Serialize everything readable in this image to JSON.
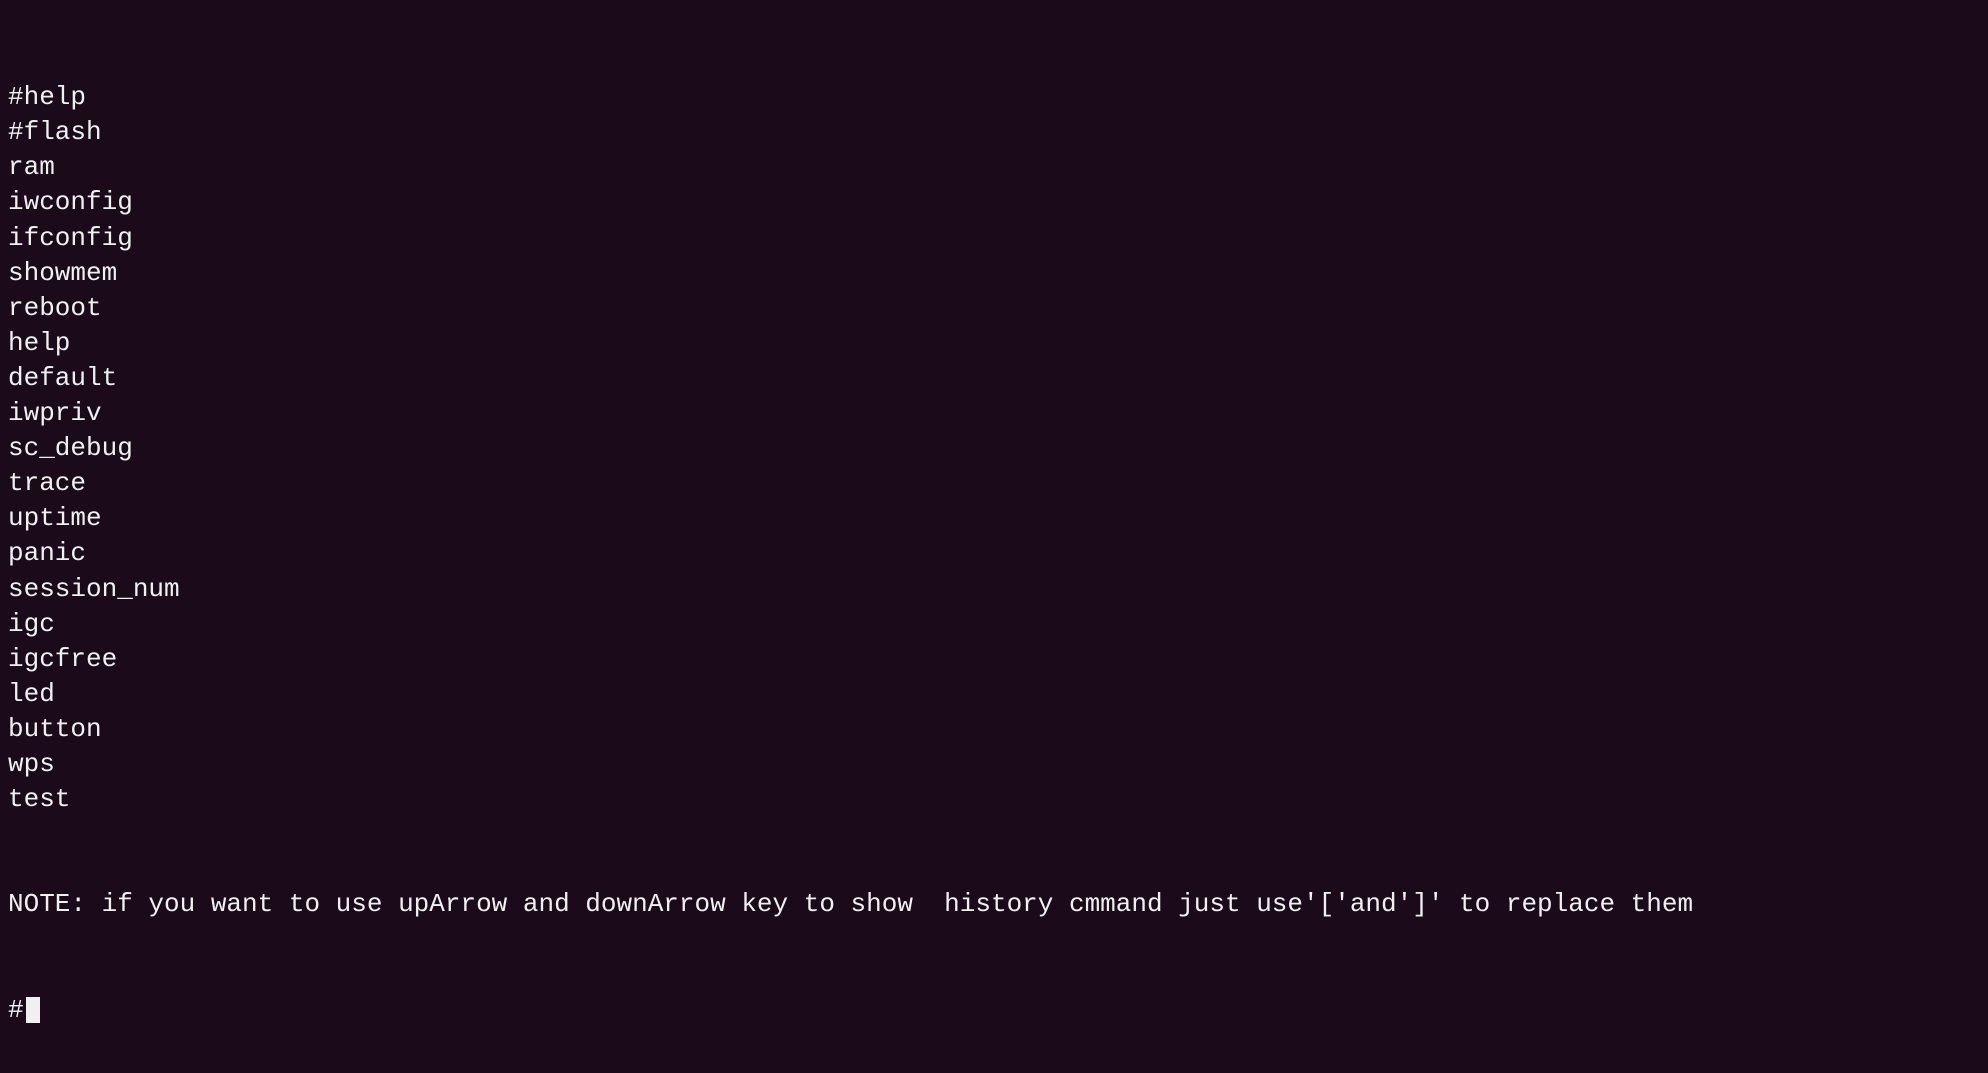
{
  "terminal": {
    "background": "#1a0a1a",
    "foreground": "#f0f0f0",
    "commands": [
      "#help",
      "#flash",
      "ram",
      "iwconfig",
      "ifconfig",
      "showmem",
      "reboot",
      "help",
      "default",
      "iwpriv",
      "sc_debug",
      "trace",
      "uptime",
      "panic",
      "session_num",
      "igc",
      "igcfree",
      "led",
      "button",
      "wps",
      "test"
    ],
    "note_line": "NOTE: if you want to use upArrow and downArrow key to show  history cmmand just use'['and']' to replace them",
    "prompt": "#"
  }
}
